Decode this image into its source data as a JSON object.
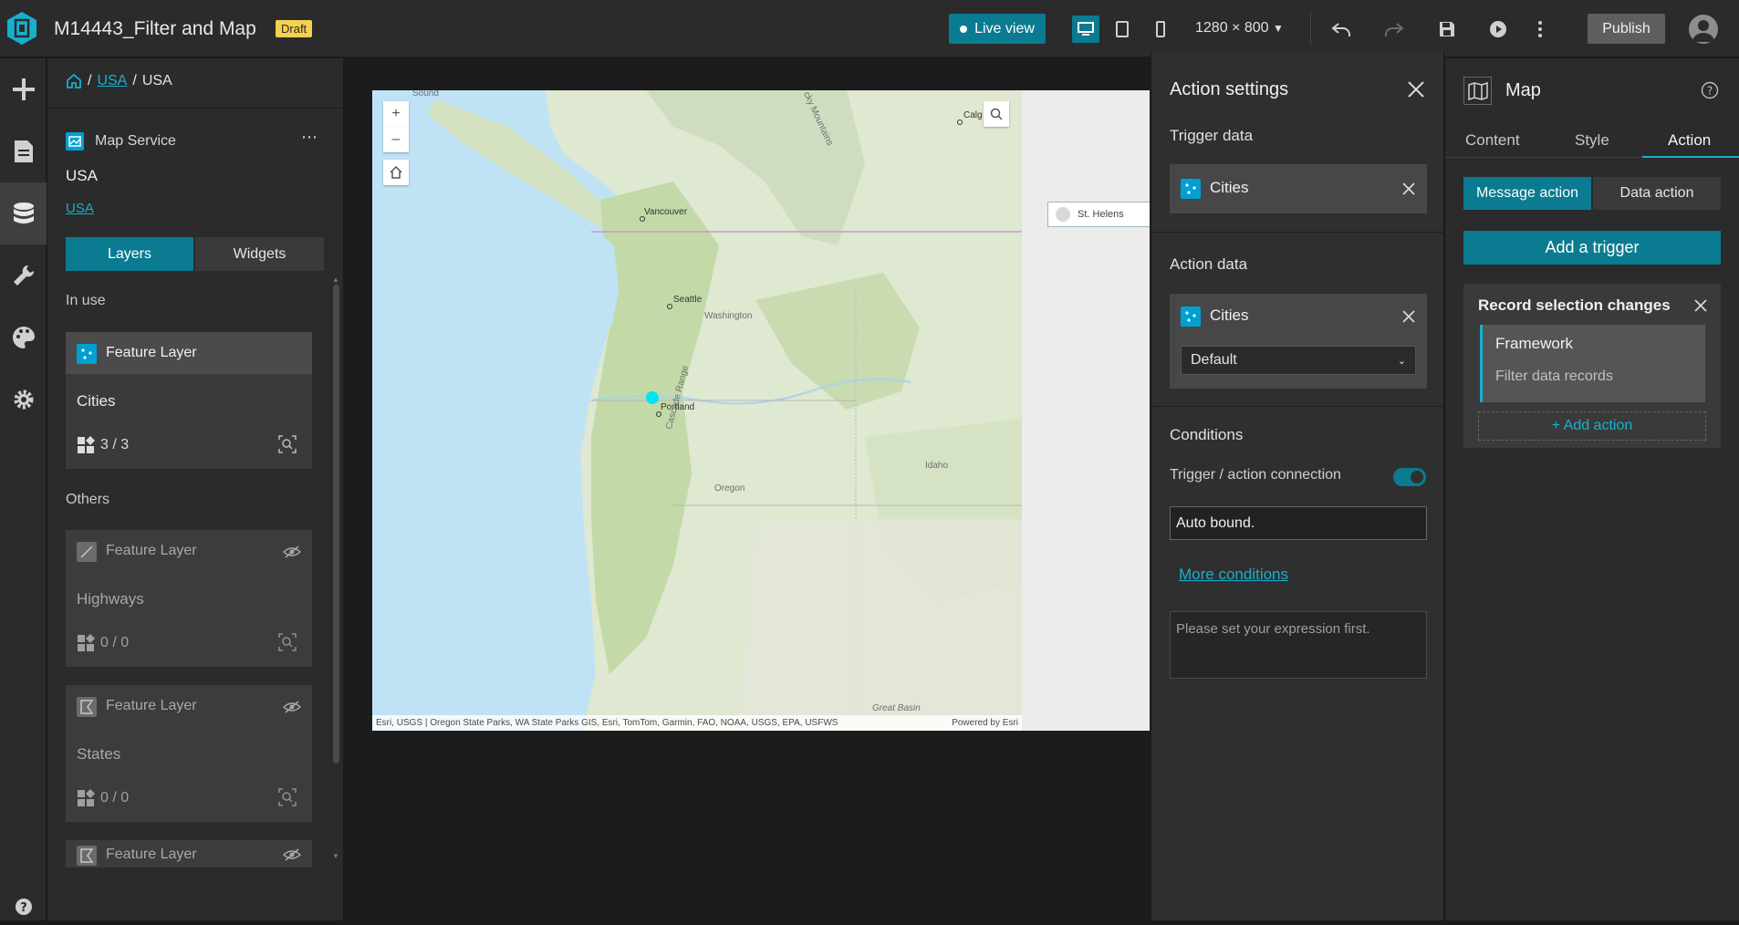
{
  "topbar": {
    "app_title": "M14443_Filter and Map",
    "draft_badge": "Draft",
    "live_view": "Live view",
    "resolution": "1280 × 800",
    "publish": "Publish"
  },
  "datapanel": {
    "breadcrumb": {
      "link": "USA",
      "current": "USA"
    },
    "service_label": "Map Service",
    "service_name": "USA",
    "service_link": "USA",
    "tabs": {
      "layers": "Layers",
      "widgets": "Widgets"
    },
    "in_use_label": "In use",
    "others_label": "Others",
    "in_use": [
      {
        "type": "Feature Layer",
        "name": "Cities",
        "count": "3 / 3"
      }
    ],
    "others": [
      {
        "type": "Feature Layer",
        "name": "Highways",
        "count": "0 / 0"
      },
      {
        "type": "Feature Layer",
        "name": "States",
        "count": "0 / 0"
      },
      {
        "type": "Feature Layer"
      }
    ]
  },
  "map": {
    "labels": {
      "vancouver": "Vancouver",
      "seattle": "Seattle",
      "washington": "Washington",
      "portland": "Portland",
      "oregon": "Oregon",
      "idaho": "Idaho",
      "calgary": "Calg",
      "cascade": "Cascade Range",
      "rocky": "cky Mountains",
      "great_basin": "Great Basin",
      "sound": "Sound"
    },
    "attribution_left": "Esri, USGS | Oregon State Parks, WA State Parks GIS, Esri, TomTom, Garmin, FAO, NOAA, USGS, EPA, USFWS",
    "attribution_right": "Powered by Esri",
    "zoom_in": "+",
    "zoom_out": "–",
    "search_chip": "St. Helens"
  },
  "action_settings": {
    "title": "Action settings",
    "trigger_data_label": "Trigger data",
    "trigger_data": "Cities",
    "action_data_label": "Action data",
    "action_data": "Cities",
    "action_select": "Default",
    "conditions_label": "Conditions",
    "connection_label": "Trigger / action connection",
    "auto_bound": "Auto bound.",
    "more_conditions": "More conditions",
    "expression_placeholder": "Please set your expression first."
  },
  "rightpanel": {
    "title": "Map",
    "tabs": [
      "Content",
      "Style",
      "Action"
    ],
    "message_action": "Message action",
    "data_action": "Data action",
    "add_trigger": "Add a trigger",
    "trigger": {
      "title": "Record selection changes",
      "action_name": "Framework",
      "action_desc": "Filter data records",
      "add_action": "+ Add action"
    }
  },
  "colors": {
    "accent": "#0a7b91",
    "link": "#17b0cf",
    "draft": "#f5d14f",
    "layer_icon": "#00a0d2"
  }
}
